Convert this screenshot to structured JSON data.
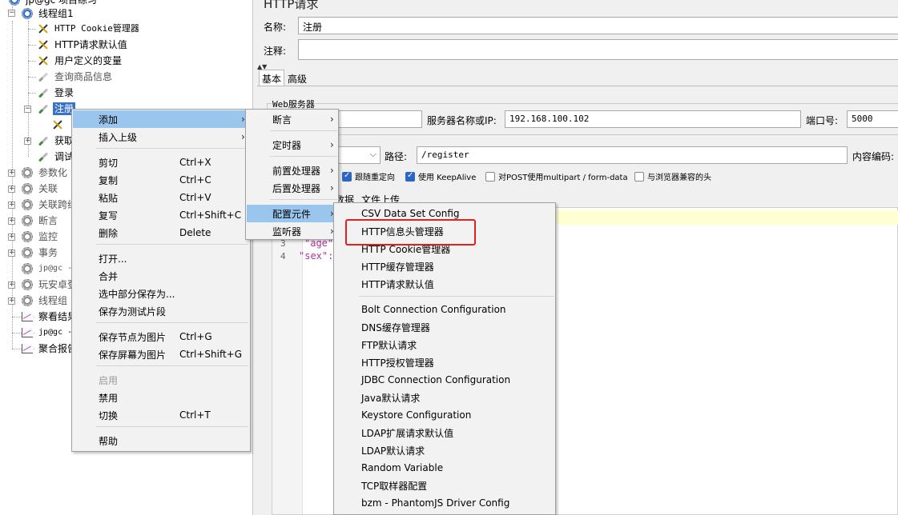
{
  "tree": {
    "root_label": "jp@gc 项目练习",
    "thread_group": "线程组1",
    "children": [
      {
        "label": "HTTP Cookie管理器"
      },
      {
        "label": "HTTP请求默认值"
      },
      {
        "label": "用户定义的变量"
      },
      {
        "label": "查询商品信息"
      },
      {
        "label": "登录"
      },
      {
        "label": "注册"
      },
      {
        "label": "获取"
      },
      {
        "label": "调试"
      }
    ],
    "others": [
      {
        "label": "参数化"
      },
      {
        "label": "关联"
      },
      {
        "label": "关联跨线"
      },
      {
        "label": "断言"
      },
      {
        "label": "监控"
      },
      {
        "label": "事务"
      },
      {
        "label": "jp@gc -"
      },
      {
        "label": "玩安卓登"
      },
      {
        "label": "线程组"
      },
      {
        "label": "察看结果"
      },
      {
        "label": "jp@gc -"
      },
      {
        "label": "聚合报告"
      }
    ]
  },
  "panel": {
    "title": "HTTP请求",
    "name_label": "名称:",
    "name_value": "注册",
    "comment_label": "注释:",
    "comment_value": "",
    "tabs": [
      "基本",
      "高级"
    ],
    "web_server_label": "Web服务器",
    "server_label": "服务器名称或IP:",
    "server_value": "192.168.100.102",
    "port_label": "端口号:",
    "port_value": "5000",
    "path_label": "路径:",
    "path_value": "/register",
    "encoding_label": "内容编码:",
    "options": [
      {
        "label": "跟随重定向",
        "checked": true
      },
      {
        "label": "使用 KeepAlive",
        "checked": true
      },
      {
        "label": "对POST使用multipart / form-data",
        "checked": false
      },
      {
        "label": "与浏览器兼容的头",
        "checked": false
      }
    ],
    "body_tabs": [
      "数据",
      "文件上传"
    ],
    "code_lines": [
      {
        "n": "3",
        "text": "\"age\":"
      },
      {
        "n": "4",
        "text": "\"sex\":"
      }
    ]
  },
  "context_menu": {
    "items": [
      {
        "label": "添加",
        "shortcut": "",
        "submenu": true,
        "hover": true
      },
      {
        "label": "插入上级",
        "shortcut": "",
        "submenu": true
      },
      {
        "label": "剪切",
        "shortcut": "Ctrl+X"
      },
      {
        "label": "复制",
        "shortcut": "Ctrl+C"
      },
      {
        "label": "粘贴",
        "shortcut": "Ctrl+V"
      },
      {
        "label": "复写",
        "shortcut": "Ctrl+Shift+C"
      },
      {
        "label": "删除",
        "shortcut": "Delete"
      },
      {
        "label": "打开...",
        "shortcut": ""
      },
      {
        "label": "合并",
        "shortcut": ""
      },
      {
        "label": "选中部分保存为...",
        "shortcut": ""
      },
      {
        "label": "保存为测试片段",
        "shortcut": ""
      },
      {
        "label": "保存节点为图片",
        "shortcut": "Ctrl+G"
      },
      {
        "label": "保存屏幕为图片",
        "shortcut": "Ctrl+Shift+G"
      },
      {
        "label": "启用",
        "shortcut": "",
        "disabled": true
      },
      {
        "label": "禁用",
        "shortcut": ""
      },
      {
        "label": "切换",
        "shortcut": "Ctrl+T"
      },
      {
        "label": "帮助",
        "shortcut": ""
      }
    ]
  },
  "add_submenu": {
    "items": [
      {
        "label": "断言"
      },
      {
        "label": "定时器"
      },
      {
        "label": "前置处理器"
      },
      {
        "label": "后置处理器"
      },
      {
        "label": "配置元件",
        "hover": true
      },
      {
        "label": "监听器"
      }
    ]
  },
  "config_submenu": {
    "items": [
      {
        "label": "CSV Data Set Config"
      },
      {
        "label": "HTTP信息头管理器",
        "highlighted": true
      },
      {
        "label": "HTTP Cookie管理器"
      },
      {
        "label": "HTTP缓存管理器"
      },
      {
        "label": "HTTP请求默认值"
      },
      {
        "label": "Bolt Connection Configuration"
      },
      {
        "label": "DNS缓存管理器"
      },
      {
        "label": "FTP默认请求"
      },
      {
        "label": "HTTP授权管理器"
      },
      {
        "label": "JDBC Connection Configuration"
      },
      {
        "label": "Java默认请求"
      },
      {
        "label": "Keystore Configuration"
      },
      {
        "label": "LDAP扩展请求默认值"
      },
      {
        "label": "LDAP默认请求"
      },
      {
        "label": "Random Variable"
      },
      {
        "label": "TCP取样器配置"
      },
      {
        "label": "bzm - PhantomJS Driver Config"
      }
    ]
  },
  "colors": {
    "menu_hover": "#9ac6ee",
    "tree_selection": "#3a73c4",
    "highlight_box": "#e02020"
  }
}
